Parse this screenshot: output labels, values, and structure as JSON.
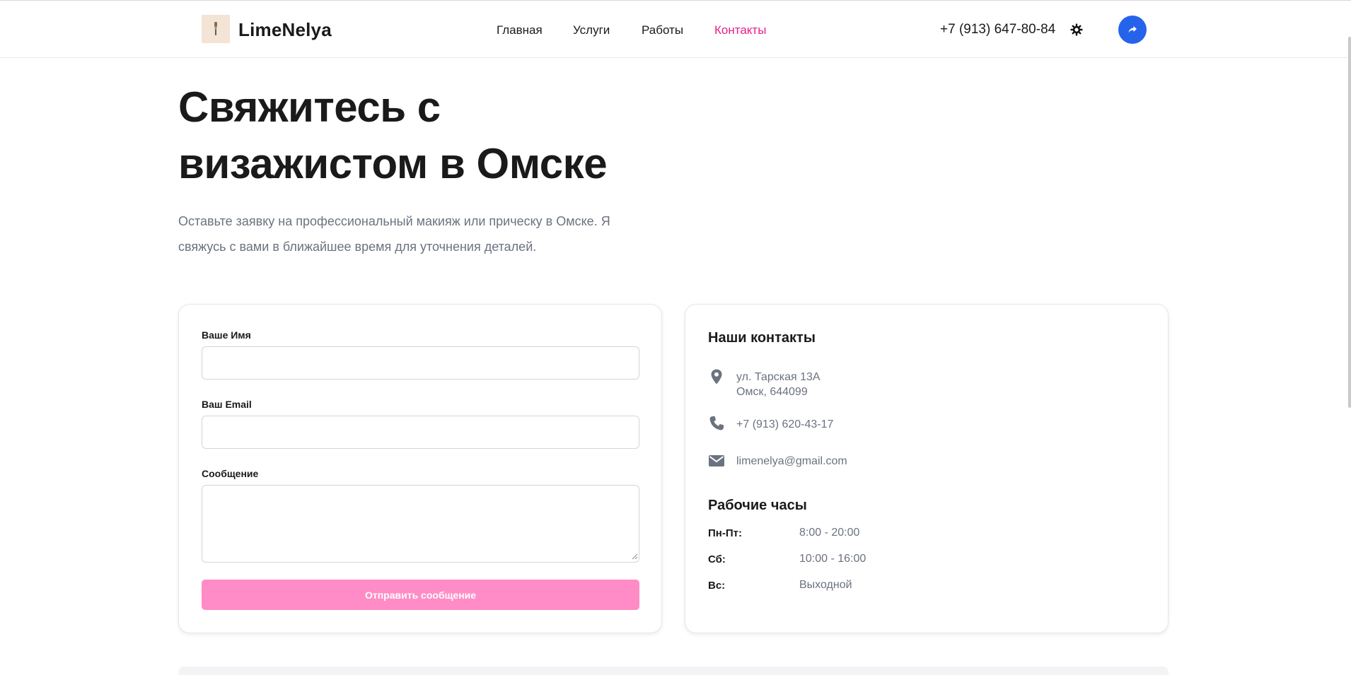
{
  "header": {
    "brand": "LimeNelya",
    "nav": [
      {
        "label": "Главная",
        "active": false
      },
      {
        "label": "Услуги",
        "active": false
      },
      {
        "label": "Работы",
        "active": false
      },
      {
        "label": "Контакты",
        "active": true
      }
    ],
    "phone": "+7 (913) 647-80-84",
    "theme_icon": "gear-icon",
    "share_icon": "share-icon"
  },
  "hero": {
    "title_line1": "Свяжитесь с",
    "title_line2": "визажистом в Омске",
    "subtitle_line1": "Оставьте заявку на профессиональный макияж или прическу в Омске. Я",
    "subtitle_line2": "свяжусь с вами в ближайшее время для уточнения деталей."
  },
  "form": {
    "name_label": "Ваше Имя",
    "name_value": "",
    "email_label": "Ваш Email",
    "email_value": "",
    "message_label": "Сообщение",
    "message_value": "",
    "submit_label": "Отправить сообщение"
  },
  "contacts": {
    "heading": "Наши контакты",
    "address_line1": "ул. Тарская 13А",
    "address_line2": "Омск, 644099",
    "phone": "+7 (913) 620-43-17",
    "email": "limenelya@gmail.com",
    "hours_heading": "Рабочие часы",
    "hours": [
      {
        "day": "Пн-Пт:",
        "time": "8:00 - 20:00"
      },
      {
        "day": "Сб:",
        "time": "10:00 - 16:00"
      },
      {
        "day": "Вс:",
        "time": "Выходной"
      }
    ]
  },
  "colors": {
    "accent_pink": "#e91e8c",
    "button_pink": "#ff8cc6",
    "share_blue": "#2563eb",
    "muted_text": "#6b7280",
    "icon_gray": "#6b7280"
  }
}
